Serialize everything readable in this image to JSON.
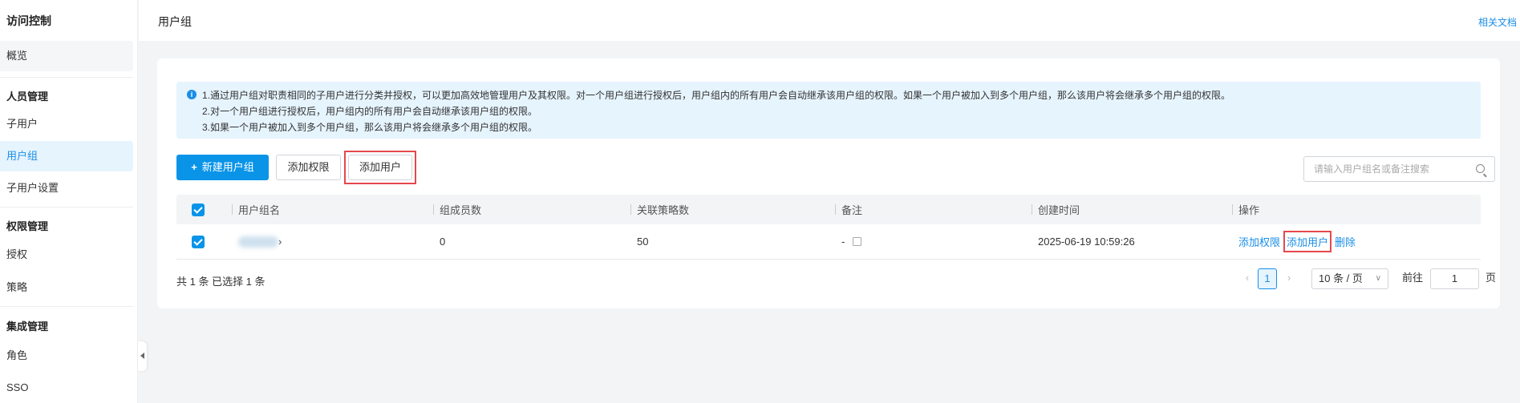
{
  "sidebar": {
    "title": "访问控制",
    "overview": "概览",
    "groups": [
      {
        "label": "人员管理",
        "items": [
          "子用户",
          "用户组",
          "子用户设置"
        ]
      },
      {
        "label": "权限管理",
        "items": [
          "授权",
          "策略"
        ]
      },
      {
        "label": "集成管理",
        "items": [
          "角色",
          "SSO"
        ]
      }
    ]
  },
  "header": {
    "title": "用户组",
    "docs_link": "相关文档"
  },
  "info": {
    "lines": [
      "1.通过用户组对职责相同的子用户进行分类并授权，可以更加高效地管理用户及其权限。对一个用户组进行授权后，用户组内的所有用户会自动继承该用户组的权限。如果一个用户被加入到多个用户组，那么该用户将会继承多个用户组的权限。",
      "2.对一个用户组进行授权后，用户组内的所有用户会自动继承该用户组的权限。",
      "3.如果一个用户被加入到多个用户组，那么该用户将会继承多个用户组的权限。"
    ]
  },
  "toolbar": {
    "new_group": "新建用户组",
    "add_permission": "添加权限",
    "add_user": "添加用户",
    "search_placeholder": "请输入用户组名或备注搜索"
  },
  "table": {
    "columns": [
      "用户组名",
      "组成员数",
      "关联策略数",
      "备注",
      "创建时间",
      "操作"
    ],
    "rows": [
      {
        "name_suffix": "›",
        "members": "0",
        "policies": "50",
        "remark": "-",
        "created": "2025-06-19 10:59:26",
        "actions": [
          "添加权限",
          "添加用户",
          "删除"
        ]
      }
    ]
  },
  "footer": {
    "summary": "共 1 条 已选择 1 条",
    "page": "1",
    "page_size": "10 条 / 页",
    "goto_label": "前往",
    "goto_value": "1",
    "page_unit": "页"
  },
  "colors": {
    "accent": "#0994e8",
    "highlight": "#e5484d"
  }
}
